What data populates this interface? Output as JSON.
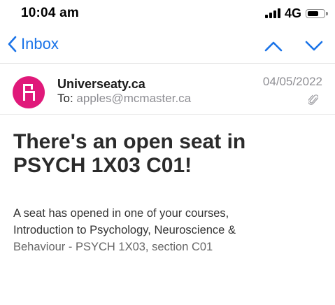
{
  "status_bar": {
    "time": "10:04 am",
    "network": "4G",
    "battery_level": 0.7
  },
  "nav": {
    "back_label": "Inbox",
    "accent_color": "#1a73e8"
  },
  "message": {
    "sender": "Universeaty.ca",
    "to_prefix": "To:",
    "to_address": "apples@mcmaster.ca",
    "date": "04/05/2022",
    "avatar_color": "#e0197a",
    "avatar_icon": "chair-icon",
    "subject_line1": "There's an open seat in",
    "subject_line2": "PSYCH 1X03 C01!",
    "body_line1": "A seat has opened in one of your courses,",
    "body_line2": "Introduction to Psychology, Neuroscience &",
    "body_line3": "Behaviour - PSYCH 1X03, section C01"
  }
}
